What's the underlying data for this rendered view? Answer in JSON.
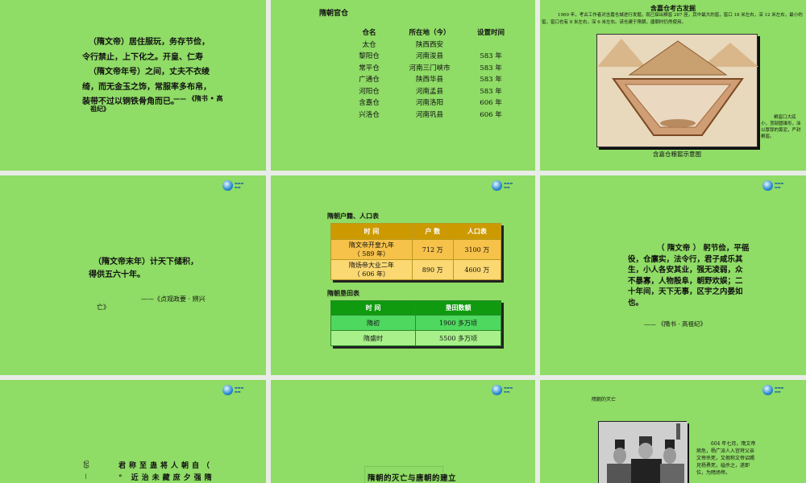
{
  "slides": {
    "s1": {
      "lines": [
        "（隋文帝）居住服玩，务存节俭，",
        "令行禁止，上下化之。开皇、仁寿",
        "（隋文帝年号）之间，丈夫不衣绫",
        "绮，而无金玉之饰，常服率多布帛，",
        "装带不过以铜铁骨角而已。"
      ],
      "source1": "—— 《隋书 • 高",
      "source2": "祖纪》"
    },
    "s2": {
      "title": "隋朝官仓",
      "headers": [
        "仓名",
        "所在地（今）",
        "设置时间"
      ],
      "rows": [
        [
          "太仓",
          "陕西西安",
          ""
        ],
        [
          "黎阳仓",
          "河南浚县",
          "583 年"
        ],
        [
          "常平仓",
          "河南三门峡市",
          "583 年"
        ],
        [
          "广通仓",
          "陕西华县",
          "583 年"
        ],
        [
          "河阳仓",
          "河南孟县",
          "583 年"
        ],
        [
          "含嘉仓",
          "河南洛阳",
          "606 年"
        ],
        [
          "兴洛仓",
          "河南巩县",
          "606 年"
        ]
      ]
    },
    "s3": {
      "title": "含嘉仓考古发掘",
      "body": "1969 年，考古工作者对含嘉仓城进行发掘，现已探出粮窖 287 座，其中最大的窖，窖口 18 米左右，深 12 米左右，最小的窖，窖口也有 8 米左右，深 6 米左右。该仓建于隋朝，唐朝时仍然使用。",
      "side_note": "粮窖口大底小，顶部圆锥形，涂以厚厚的黄泥，严封粮窖。",
      "caption": "含嘉仓粮窖示意图"
    },
    "s4": {
      "lines": [
        "（隋文帝末年）计天下储积，",
        "得供五六十年。"
      ],
      "source1": "——《贞观政要 · 辨兴",
      "source2": "亡》"
    },
    "s5": {
      "title1": "隋朝户籍、人口表",
      "headers1": [
        "时 间",
        "户 数",
        "人口表"
      ],
      "rows1": [
        {
          "time1": "隋文帝开皇九年",
          "time2": "（ 589 年）",
          "households": "712 万",
          "population": "3100 万"
        },
        {
          "time1": "隋炀帝大业二年",
          "time2": "（ 606 年）",
          "households": "890 万",
          "population": "4600 万"
        }
      ],
      "title2": "隋朝垦田表",
      "headers2": [
        "时 间",
        "垦田数额"
      ],
      "rows2": [
        [
          "隋初",
          "1900 多万顷"
        ],
        [
          "隋盛时",
          "5500 多万顷"
        ]
      ]
    },
    "s6": {
      "lines": [
        "（ 隋文帝 ） 躬节俭，平徭",
        "役，仓廪实，法令行，君子咸乐其",
        "生，小人各安其业，强无凌弱，众",
        "不暴寡，人物殷阜，朝野欢娱；二",
        "十年间，天下无事，区宇之内晏如",
        "也。"
      ],
      "source": "—— 《隋书 · 高祖纪》"
    },
    "s7": {
      "row1": "君称至蛊将人朝自（",
      "row2": "° 近治未藏庶夕强隋",
      "side": "纪》 — 《隋"
    },
    "s8": {
      "title": "隋朝的灭亡与唐朝的建立"
    },
    "s9": {
      "title": "隋朝的灭亡",
      "body": "604 年七月，隋文帝病危，杨广派人入宫将父亲文帝杀死，又假称文帝诏赐兄杨勇死，缢杀之，遂即位，为隋炀帝。"
    }
  },
  "colors": {
    "slide_bg": "#8fdc66",
    "gold_header": "#cc9a00",
    "green_header": "#0f9a0f"
  }
}
